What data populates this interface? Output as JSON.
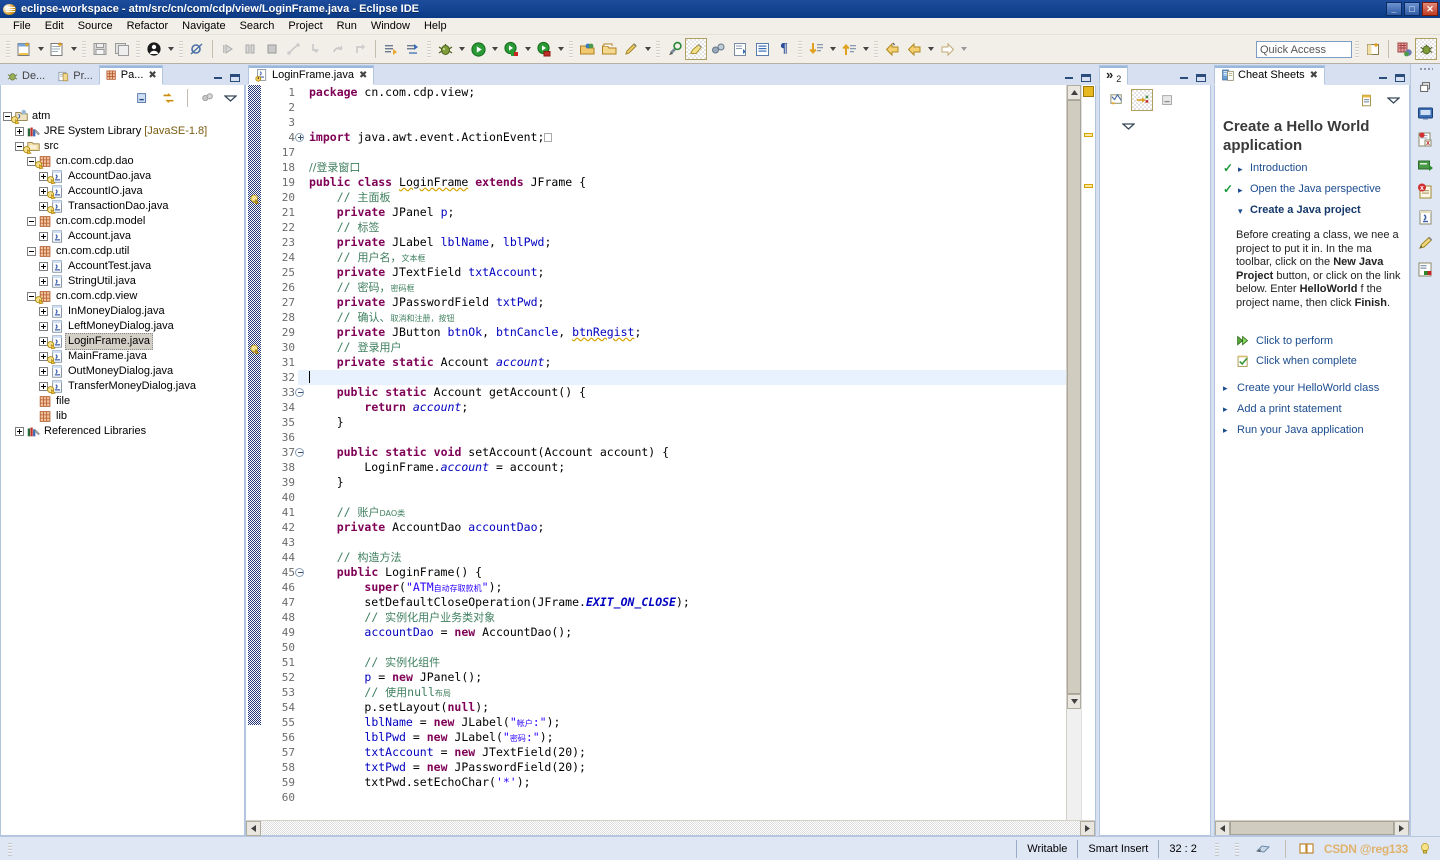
{
  "window": {
    "title": "eclipse-workspace - atm/src/cn/com/cdp/view/LoginFrame.java - Eclipse IDE",
    "app_icon": "eclipse-icon",
    "minimize": "_",
    "maximize": "□",
    "close": "✕"
  },
  "menubar": {
    "items": [
      {
        "label": "File"
      },
      {
        "label": "Edit"
      },
      {
        "label": "Source"
      },
      {
        "label": "Refactor"
      },
      {
        "label": "Navigate"
      },
      {
        "label": "Search"
      },
      {
        "label": "Project"
      },
      {
        "label": "Run"
      },
      {
        "label": "Window"
      },
      {
        "label": "Help"
      }
    ]
  },
  "toolbar": {
    "quick_access_placeholder": "Quick Access",
    "quick_access_value": "",
    "groups": [
      [
        "new-wizard-icon",
        "dropdown-arrow",
        "new-java-class-icon",
        "dropdown-arrow"
      ],
      [
        "save-icon",
        "save-all-icon"
      ],
      [
        "user-account-icon",
        "dropdown-arrow"
      ],
      [
        "skip-all-breakpoints-icon"
      ],
      [
        "resume-icon",
        "suspend-icon",
        "terminate-icon",
        "disconnect-icon",
        "step-into-icon",
        "step-over-icon",
        "step-return-icon"
      ],
      [
        "next-annotation-icon",
        "previous-annotation-icon"
      ],
      [
        "debug-icon",
        "dropdown-arrow",
        "run-icon",
        "dropdown-arrow",
        "run-coverage-icon",
        "dropdown-arrow",
        "external-tools-icon",
        "dropdown-arrow"
      ],
      [
        "open-type-icon",
        "open-task-icon",
        "new-annotation-icon",
        "dropdown-arrow"
      ],
      [
        "search-icon",
        "toggle-mark-occurrences-icon",
        "link-with-editor-icon",
        "toggle-block-selection-icon",
        "show-whitespace-icon",
        "pilcrow-icon"
      ],
      [
        "next-edit-icon",
        "dropdown-arrow",
        "previous-edit-icon",
        "dropdown-arrow"
      ],
      [
        "back-icon",
        "forward-icon",
        "dropdown-arrow",
        "forward-nav-icon",
        "dropdown-arrow"
      ]
    ],
    "perspective_buttons": [
      "open-perspective-icon",
      "java-perspective-icon",
      "debug-perspective-icon"
    ]
  },
  "package_explorer": {
    "tabs": [
      {
        "label": "De...",
        "icon": "debug-view-icon",
        "active": false,
        "closeable": false
      },
      {
        "label": "Pr...",
        "icon": "project-explorer-icon",
        "active": false,
        "closeable": false
      },
      {
        "label": "Pa...",
        "icon": "package-explorer-icon",
        "active": true,
        "closeable": true
      }
    ],
    "view_toolbar": [
      "collapse-all-icon",
      "link-with-editor-icon",
      "focus-on-active-task-icon",
      "view-menu-icon"
    ],
    "tree": [
      {
        "depth": 0,
        "toggle": "minus",
        "icon": "java-project-icon",
        "label": "atm",
        "warning": true,
        "selected": false
      },
      {
        "depth": 1,
        "toggle": "plus",
        "icon": "jre-library-icon",
        "label": "JRE System Library",
        "suffix": "[JavaSE-1.8]",
        "selected": false
      },
      {
        "depth": 1,
        "toggle": "minus",
        "icon": "source-folder-icon",
        "label": "src",
        "warning": true,
        "selected": false
      },
      {
        "depth": 2,
        "toggle": "minus",
        "icon": "package-icon",
        "label": "cn.com.cdp.dao",
        "warning": true,
        "selected": false
      },
      {
        "depth": 3,
        "toggle": "plus",
        "icon": "java-file-icon",
        "label": "AccountDao.java",
        "warning": true,
        "selected": false
      },
      {
        "depth": 3,
        "toggle": "plus",
        "icon": "java-file-icon",
        "label": "AccountIO.java",
        "warning": true,
        "selected": false
      },
      {
        "depth": 3,
        "toggle": "plus",
        "icon": "java-file-icon",
        "label": "TransactionDao.java",
        "warning": true,
        "selected": false
      },
      {
        "depth": 2,
        "toggle": "minus",
        "icon": "package-icon",
        "label": "cn.com.cdp.model",
        "selected": false
      },
      {
        "depth": 3,
        "toggle": "plus",
        "icon": "java-file-icon",
        "label": "Account.java",
        "selected": false
      },
      {
        "depth": 2,
        "toggle": "minus",
        "icon": "package-icon",
        "label": "cn.com.cdp.util",
        "selected": false
      },
      {
        "depth": 3,
        "toggle": "plus",
        "icon": "java-file-icon",
        "label": "AccountTest.java",
        "selected": false
      },
      {
        "depth": 3,
        "toggle": "plus",
        "icon": "java-file-icon",
        "label": "StringUtil.java",
        "selected": false
      },
      {
        "depth": 2,
        "toggle": "minus",
        "icon": "package-icon",
        "label": "cn.com.cdp.view",
        "warning": true,
        "selected": false
      },
      {
        "depth": 3,
        "toggle": "plus",
        "icon": "java-file-icon",
        "label": "InMoneyDialog.java",
        "selected": false
      },
      {
        "depth": 3,
        "toggle": "plus",
        "icon": "java-file-icon",
        "label": "LeftMoneyDialog.java",
        "selected": false
      },
      {
        "depth": 3,
        "toggle": "plus",
        "icon": "java-file-icon",
        "label": "LoginFrame.java",
        "warning": true,
        "selected": true
      },
      {
        "depth": 3,
        "toggle": "plus",
        "icon": "java-file-icon",
        "label": "MainFrame.java",
        "warning": true,
        "selected": false
      },
      {
        "depth": 3,
        "toggle": "plus",
        "icon": "java-file-icon",
        "label": "OutMoneyDialog.java",
        "selected": false
      },
      {
        "depth": 3,
        "toggle": "plus",
        "icon": "java-file-icon",
        "label": "TransferMoneyDialog.java",
        "warning": true,
        "selected": false
      },
      {
        "depth": 2,
        "toggle": "none",
        "icon": "package-icon",
        "label": "file",
        "selected": false
      },
      {
        "depth": 2,
        "toggle": "none",
        "icon": "package-icon",
        "label": "lib",
        "selected": false
      },
      {
        "depth": 1,
        "toggle": "plus",
        "icon": "referenced-libraries-icon",
        "label": "Referenced Libraries",
        "selected": false
      }
    ]
  },
  "editor": {
    "tab": {
      "label": "LoginFrame.java",
      "icon": "java-file-warning-icon",
      "close": "✖",
      "active": true
    },
    "lines": [
      {
        "num": "1",
        "fold": "none",
        "html": "<span class=\"kw\">package</span> cn.com.cdp.view;"
      },
      {
        "num": "2",
        "fold": "none",
        "html": ""
      },
      {
        "num": "3",
        "fold": "none",
        "html": ""
      },
      {
        "num": "4",
        "fold": "plus",
        "html": "<span class=\"kw\">import</span> java.awt.event.ActionEvent;<span class=\"foldmark\"></span>"
      },
      {
        "num": "17",
        "fold": "none",
        "html": ""
      },
      {
        "num": "18",
        "fold": "none",
        "html": "<span class=\"cm zh\">//登录窗口</span>"
      },
      {
        "num": "19",
        "fold": "none",
        "html": "<span class=\"kw\">public</span> <span class=\"kw\">class</span> <span class=\"wav\">LoginFrame</span> <span class=\"kw\">extends</span> JFrame {"
      },
      {
        "num": "20",
        "fold": "none",
        "html": "    <span class=\"cm\">// <span class=\"zh\">主面板</span></span>"
      },
      {
        "num": "21",
        "fold": "none",
        "html": "    <span class=\"kw\">private</span> JPanel <span class=\"fld\">p</span>;"
      },
      {
        "num": "22",
        "fold": "none",
        "html": "    <span class=\"cm\">// <span class=\"zh\">标签</span></span>"
      },
      {
        "num": "23",
        "fold": "none",
        "html": "    <span class=\"kw\">private</span> JLabel <span class=\"fld\">lblName</span>, <span class=\"fld\">lblPwd</span>;"
      },
      {
        "num": "24",
        "fold": "none",
        "html": "    <span class=\"cm\">// <span class=\"zh\">用户名，</span><span class=\"zhs\">文本框</span></span>"
      },
      {
        "num": "25",
        "fold": "none",
        "html": "    <span class=\"kw\">private</span> JTextField <span class=\"fld\">txtAccount</span>;"
      },
      {
        "num": "26",
        "fold": "none",
        "html": "    <span class=\"cm\">// <span class=\"zh\">密码，</span><span class=\"zhs\">密码框</span></span>"
      },
      {
        "num": "27",
        "fold": "none",
        "html": "    <span class=\"kw\">private</span> JPasswordField <span class=\"fld\">txtPwd</span>;"
      },
      {
        "num": "28",
        "fold": "none",
        "html": "    <span class=\"cm\">// <span class=\"zh\">确认、</span><span class=\"zhs\">取消和注册，按钮</span></span>"
      },
      {
        "num": "29",
        "fold": "none",
        "html": "    <span class=\"kw\">private</span> JButton <span class=\"fld\">btnOk</span>, <span class=\"fld\">btnCancle</span>, <span class=\"fld wav\">btnRegist</span>;"
      },
      {
        "num": "30",
        "fold": "none",
        "html": "    <span class=\"cm\">// <span class=\"zh\">登录用户</span></span>"
      },
      {
        "num": "31",
        "fold": "none",
        "html": "    <span class=\"kw\">private</span> <span class=\"kw\">static</span> Account <span class=\"stat\">account</span>;"
      },
      {
        "num": "32",
        "fold": "none",
        "current": true,
        "html": "<span class=\"caretbar\"></span>"
      },
      {
        "num": "33",
        "fold": "minus",
        "html": "    <span class=\"kw\">public</span> <span class=\"kw\">static</span> Account getAccount() {"
      },
      {
        "num": "34",
        "fold": "none",
        "html": "        <span class=\"kw\">return</span> <span class=\"stat\">account</span>;"
      },
      {
        "num": "35",
        "fold": "none",
        "html": "    }"
      },
      {
        "num": "36",
        "fold": "none",
        "html": ""
      },
      {
        "num": "37",
        "fold": "minus",
        "html": "    <span class=\"kw\">public</span> <span class=\"kw\">static</span> <span class=\"kw\">void</span> setAccount(Account account) {"
      },
      {
        "num": "38",
        "fold": "none",
        "html": "        LoginFrame.<span class=\"stat\">account</span> = account;"
      },
      {
        "num": "39",
        "fold": "none",
        "html": "    }"
      },
      {
        "num": "40",
        "fold": "none",
        "html": ""
      },
      {
        "num": "41",
        "fold": "none",
        "html": "    <span class=\"cm\">// <span class=\"zh\">账户</span><span class=\"zhs\">DAO类</span></span>"
      },
      {
        "num": "42",
        "fold": "none",
        "html": "    <span class=\"kw\">private</span> AccountDao <span class=\"fld\">accountDao</span>;"
      },
      {
        "num": "43",
        "fold": "none",
        "html": ""
      },
      {
        "num": "44",
        "fold": "none",
        "html": "    <span class=\"cm\">// <span class=\"zh\">构造方法</span></span>"
      },
      {
        "num": "45",
        "fold": "minus",
        "html": "    <span class=\"kw\">public</span> LoginFrame() {"
      },
      {
        "num": "46",
        "fold": "none",
        "html": "        <span class=\"kw\">super</span>(<span class=\"st\">\"ATM</span><span class=\"st zhs\">自动存取款机</span><span class=\"st\">\"</span>);"
      },
      {
        "num": "47",
        "fold": "none",
        "html": "        setDefaultCloseOperation(JFrame.<span class=\"statb\">EXIT_ON_CLOSE</span>);"
      },
      {
        "num": "48",
        "fold": "none",
        "html": "        <span class=\"cm\">// <span class=\"zh\">实例化用户业务类对象</span></span>"
      },
      {
        "num": "49",
        "fold": "none",
        "html": "        <span class=\"fld\">accountDao</span> = <span class=\"kw\">new</span> AccountDao();"
      },
      {
        "num": "50",
        "fold": "none",
        "html": ""
      },
      {
        "num": "51",
        "fold": "none",
        "html": "        <span class=\"cm\">// <span class=\"zh\">实例化组件</span></span>"
      },
      {
        "num": "52",
        "fold": "none",
        "html": "        <span class=\"fld\">p</span> = <span class=\"kw\">new</span> JPanel();"
      },
      {
        "num": "53",
        "fold": "none",
        "html": "        <span class=\"cm\">// <span class=\"zh\">使用</span>null<span class=\"zhs\">布局</span></span>"
      },
      {
        "num": "54",
        "fold": "none",
        "html": "        p.setLayout(<span class=\"kw\">null</span>);"
      },
      {
        "num": "55",
        "fold": "none",
        "html": "        <span class=\"fld\">lblName</span> = <span class=\"kw\">new</span> JLabel(<span class=\"st\">\"</span><span class=\"st zhs\">帐户</span><span class=\"st\">:\"</span>);"
      },
      {
        "num": "56",
        "fold": "none",
        "html": "        <span class=\"fld\">lblPwd</span> = <span class=\"kw\">new</span> JLabel(<span class=\"st\">\"</span><span class=\"st zhs\">密码</span><span class=\"st\">:\"</span>);"
      },
      {
        "num": "57",
        "fold": "none",
        "html": "        <span class=\"fld\">txtAccount</span> = <span class=\"kw\">new</span> JTextField(20);"
      },
      {
        "num": "58",
        "fold": "none",
        "html": "        <span class=\"fld\">txtPwd</span> = <span class=\"kw\">new</span> JPasswordField(20);"
      },
      {
        "num": "59",
        "fold": "none",
        "html": "        txtPwd.setEchoChar(<span class=\"st\">'*'</span>);"
      },
      {
        "num": "60",
        "fold": "none",
        "html": ""
      }
    ],
    "marker_warnings_at_lines": [
      "19",
      "29"
    ]
  },
  "outline_view": {
    "overflow_label": "»",
    "overflow_count": "2",
    "toolbar_icons": [
      "sort-icon",
      "hide-fields-icon",
      "collapse-all-icon",
      "view-menu-icon"
    ]
  },
  "cheat_sheets": {
    "tab_label": "Cheat Sheets",
    "tab_icon": "cheat-sheet-icon",
    "close": "✖",
    "toolbar_icons": [
      "cheat-sheet-menu-icon",
      "view-menu-icon"
    ],
    "title": "Create a Hello World application",
    "steps": [
      {
        "label": "Introduction",
        "state": "done"
      },
      {
        "label": "Open the Java perspective",
        "state": "done"
      },
      {
        "label": "Create a Java project",
        "state": "active"
      }
    ],
    "body_html": "Before creating a class, we nee a project to put it in. In the ma toolbar, click on the <b>New Java Project</b> button, or click on the link below. Enter <b>HelloWorld</b> f the project name, then click <b>Finish</b>.",
    "actions": [
      {
        "label": "Click to perform",
        "icon": "perform-icon"
      },
      {
        "label": "Click when complete",
        "icon": "complete-icon"
      }
    ],
    "remaining_steps": [
      {
        "label": "Create your HelloWorld class"
      },
      {
        "label": "Add a print statement"
      },
      {
        "label": "Run your Java application"
      }
    ]
  },
  "fast_view_rail": {
    "icons": [
      "restore-icon",
      "console-view-icon",
      "problems-view-icon",
      "servers-view-icon",
      "error-log-icon",
      "javadoc-view-icon",
      "declaration-view-icon",
      "snippets-view-icon"
    ]
  },
  "status_bar": {
    "writable": "Writable",
    "insert_mode": "Smart Insert",
    "position": "32 : 2",
    "watermark": "CSDN @reg133",
    "right_icons": [
      "smart-insert-icon",
      "book-icon",
      "tip-icon"
    ]
  },
  "colors": {
    "title_bar": "#0a3a86",
    "chrome": "#f1efe7",
    "panel_bg": "#d6e0f0",
    "editor_bg": "#ffffff",
    "keyword": "#7f0055",
    "comment": "#3f7f5f",
    "string": "#2a00ff",
    "field": "#0000c0",
    "selection": "#d4d0c8",
    "current_line": "#e8f2fe",
    "link": "#1b4b8f"
  }
}
